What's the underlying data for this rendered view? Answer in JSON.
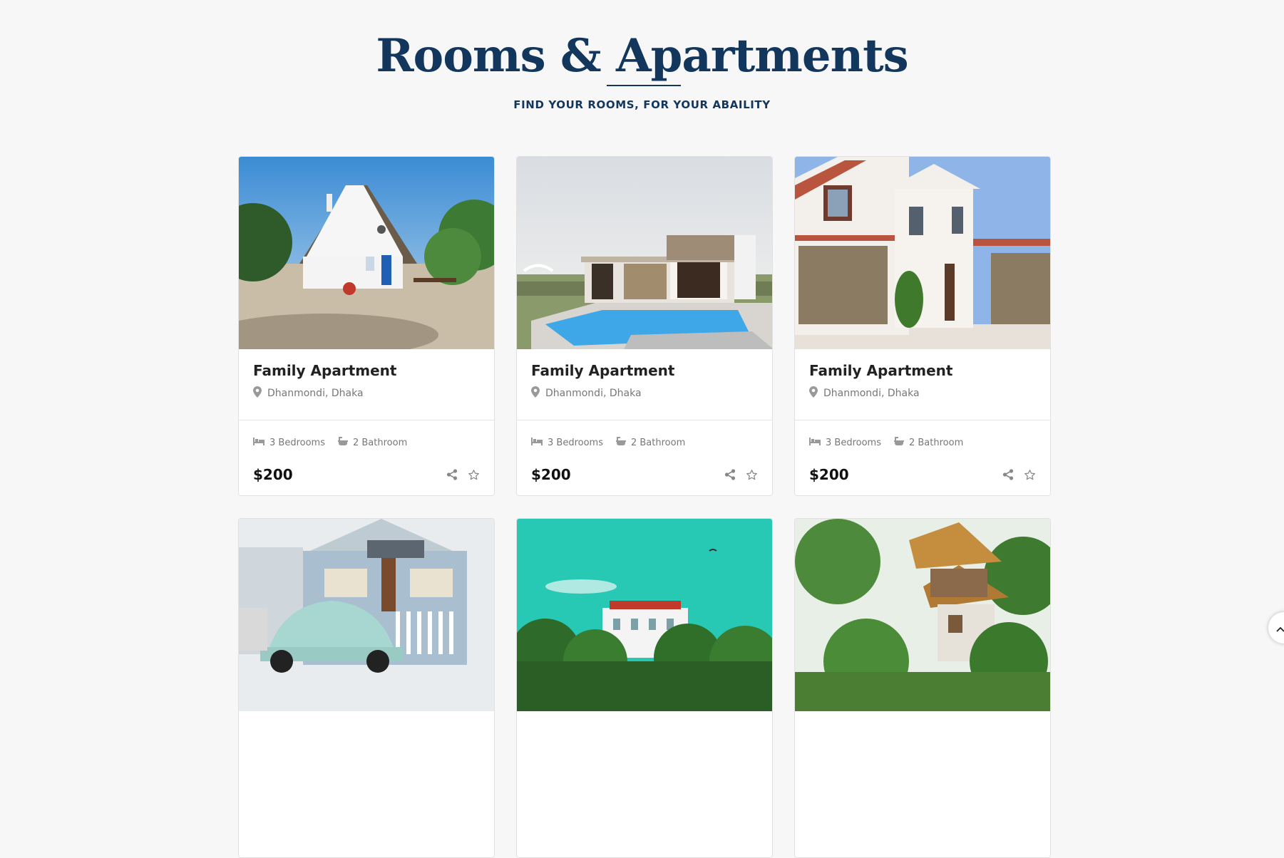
{
  "header": {
    "title": "Rooms & Apartments",
    "subtitle": "FIND YOUR ROOMS, FOR YOUR ABAILITY"
  },
  "colors": {
    "heading": "#13365c",
    "text": "#222222",
    "muted": "#777777"
  },
  "cards": [
    {
      "title": "Family Apartment",
      "location": "Dhanmondi, Dhaka",
      "bedrooms": "3 Bedrooms",
      "bathrooms": "2 Bathroom",
      "price": "$200",
      "photo": "white-cottage"
    },
    {
      "title": "Family Apartment",
      "location": "Dhanmondi, Dhaka",
      "bedrooms": "3 Bedrooms",
      "bathrooms": "2 Bathroom",
      "price": "$200",
      "photo": "modern-house-pool"
    },
    {
      "title": "Family Apartment",
      "location": "Dhanmondi, Dhaka",
      "bedrooms": "3 Bedrooms",
      "bathrooms": "2 Bathroom",
      "price": "$200",
      "photo": "white-villa-garage"
    },
    {
      "title": "",
      "location": "",
      "bedrooms": "",
      "bathrooms": "",
      "price": "",
      "photo": "house-with-beetle"
    },
    {
      "title": "",
      "location": "",
      "bedrooms": "",
      "bathrooms": "",
      "price": "",
      "photo": "hilltop-mansion"
    },
    {
      "title": "",
      "location": "",
      "bedrooms": "",
      "bathrooms": "",
      "price": "",
      "photo": "thatched-treehouse"
    }
  ],
  "icons": {
    "location": "map-pin-icon",
    "bed": "bed-icon",
    "bath": "bathtub-icon",
    "share": "share-icon",
    "favorite": "star-icon",
    "scroll_top": "chevron-up-icon"
  }
}
